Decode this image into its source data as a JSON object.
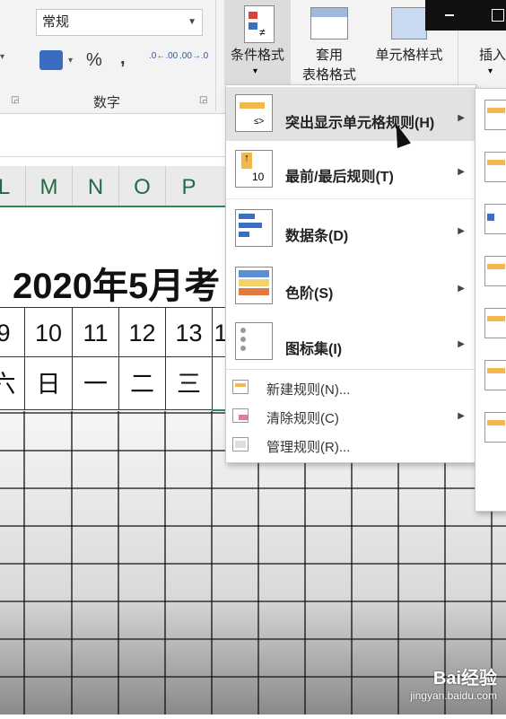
{
  "ribbon": {
    "number_format_value": "常规",
    "number_group_label": "数字",
    "percent_symbol": "%",
    "comma_symbol": ",",
    "increase_decimal": ".0←.00",
    "decrease_decimal": ".00→.0",
    "conditional_format_label": "条件格式",
    "table_format_label_1": "套用",
    "table_format_label_2": "表格格式",
    "cell_style_label": "单元格样式",
    "insert_label": "插入"
  },
  "sheet": {
    "columns": [
      "L",
      "M",
      "N",
      "O",
      "P"
    ],
    "title": "2020年5月考",
    "day_numbers": [
      "9",
      "10",
      "11",
      "12",
      "13",
      "1"
    ],
    "weekdays": [
      "六",
      "日",
      "一",
      "二",
      "三"
    ]
  },
  "menu": {
    "items": [
      {
        "label": "突出显示单元格规则(H)",
        "icon": "highlight-rules-icon",
        "highlighted": true
      },
      {
        "label": "最前/最后规则(T)",
        "icon": "top-bottom-rules-icon"
      },
      {
        "label": "数据条(D)",
        "icon": "data-bars-icon"
      },
      {
        "label": "色阶(S)",
        "icon": "color-scales-icon"
      },
      {
        "label": "图标集(I)",
        "icon": "icon-sets-icon"
      }
    ],
    "small_items": [
      {
        "label": "新建规则(N)...",
        "icon": "new-rule-icon"
      },
      {
        "label": "清除规则(C)",
        "icon": "clear-rules-icon"
      },
      {
        "label": "管理规则(R)...",
        "icon": "manage-rules-icon"
      }
    ]
  },
  "watermark": {
    "brand": "Bai经验",
    "url": "jingyan.baidu.com"
  },
  "colors": {
    "accent_green": "#2e8b57",
    "menu_hover": "#e2e2e2",
    "bar_blue": "#3b6fc4"
  }
}
